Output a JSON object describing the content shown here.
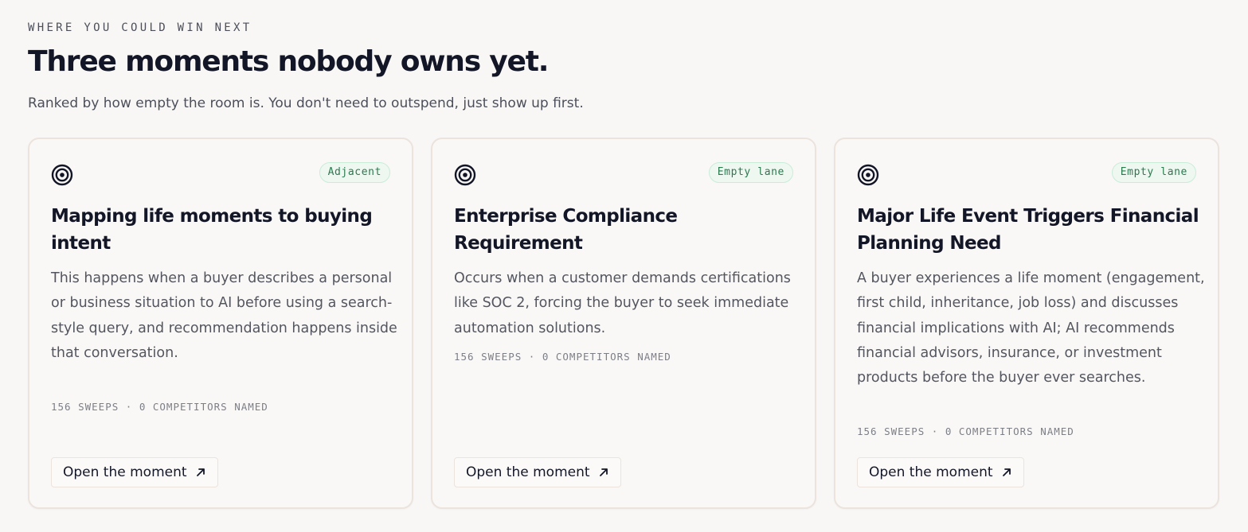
{
  "header": {
    "eyebrow": "WHERE YOU COULD WIN NEXT",
    "title": "Three moments nobody owns yet.",
    "subtitle": "Ranked by how empty the room is. You don't need to outspend, just show up first."
  },
  "cards": [
    {
      "icon": "target-icon",
      "badge": "Adjacent",
      "title": "Mapping life moments to buying intent",
      "description": "This happens when a buyer describes a personal or business situation to AI before using a search-style query, and recommendation happens inside that conversation.",
      "meta": "156 SWEEPS · 0 COMPETITORS NAMED",
      "button_label": "Open the moment",
      "button_icon": "arrow-up-right-icon"
    },
    {
      "icon": "target-icon",
      "badge": "Empty lane",
      "title": "Enterprise Compliance Requirement",
      "description": "Occurs when a customer demands certifications like SOC 2, forcing the buyer to seek immediate automation solutions.",
      "meta": "156 SWEEPS · 0 COMPETITORS NAMED",
      "button_label": "Open the moment",
      "button_icon": "arrow-up-right-icon"
    },
    {
      "icon": "target-icon",
      "badge": "Empty lane",
      "title": "Major Life Event Triggers Financial Planning Need",
      "description": "A buyer experiences a life moment (engagement, first child, inheritance, job loss) and discusses financial implications with AI; AI recommends financial advisors, insurance, or investment products before the buyer ever searches.",
      "meta": "156 SWEEPS · 0 COMPETITORS NAMED",
      "button_label": "Open the moment",
      "button_icon": "arrow-up-right-icon"
    }
  ],
  "colors": {
    "background": "#f8f7f6",
    "card_border": "#ebe3dc",
    "badge_bg": "#eef8f1",
    "badge_text": "#2b7a4e",
    "heading": "#131626"
  }
}
